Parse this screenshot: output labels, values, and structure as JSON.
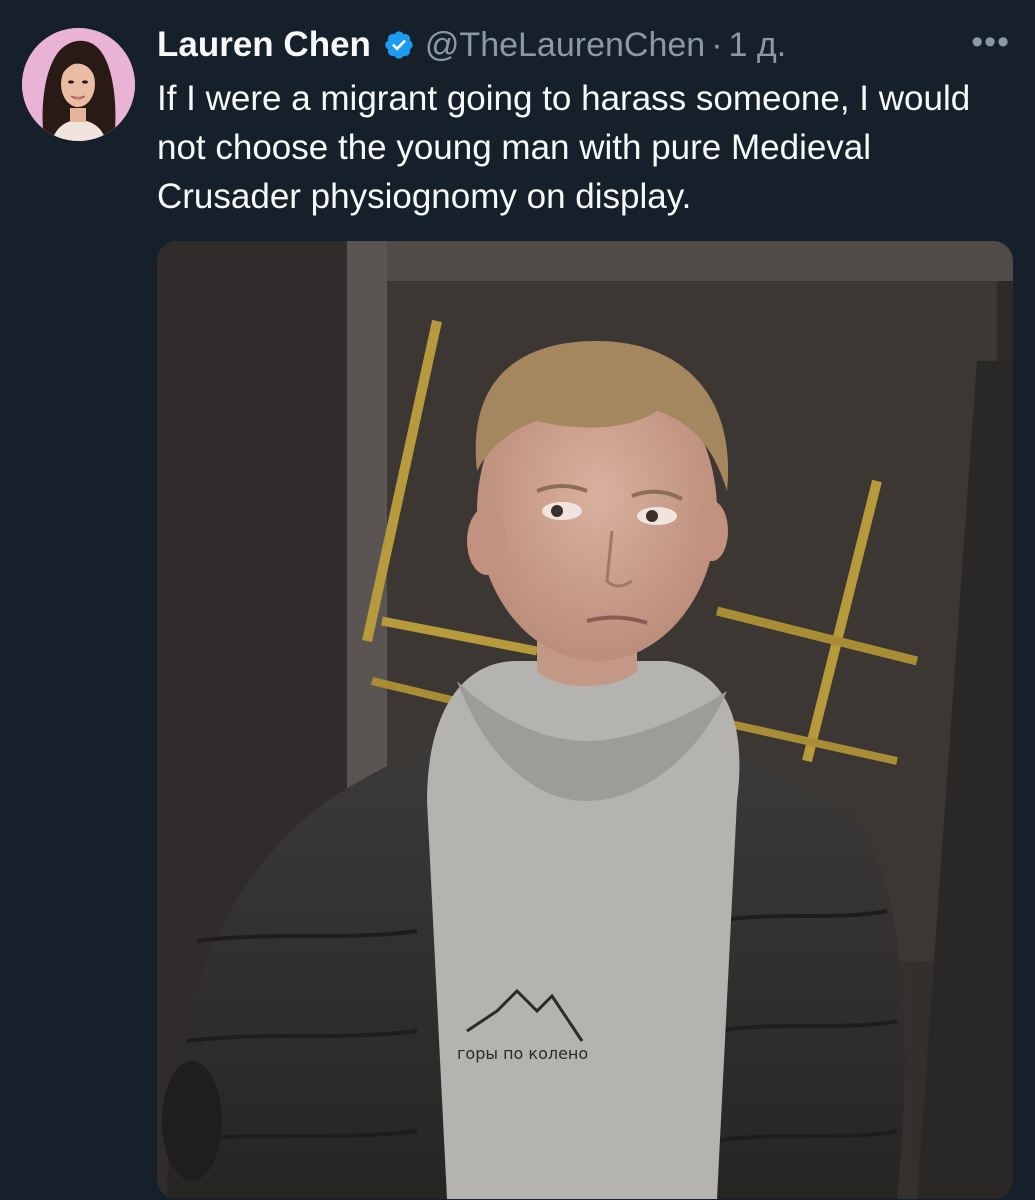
{
  "tweet": {
    "author_name": "Lauren Chen",
    "handle": "@TheLaurenChen",
    "separator": "·",
    "time": "1 д.",
    "more_label": "•••",
    "text": "If I were a migrant going to harass someone, I would not choose the young man with pure Medieval Crusader physiognomy on display.",
    "media_shirt_text": "горы по колено",
    "icons": {
      "avatar": "avatar-photo",
      "verified": "verified-badge-icon",
      "more": "more-options-icon"
    },
    "colors": {
      "background": "#15202b",
      "primary_text": "#f7f9f9",
      "secondary_text": "#8b98a5",
      "verified": "#1d9bf0"
    }
  }
}
